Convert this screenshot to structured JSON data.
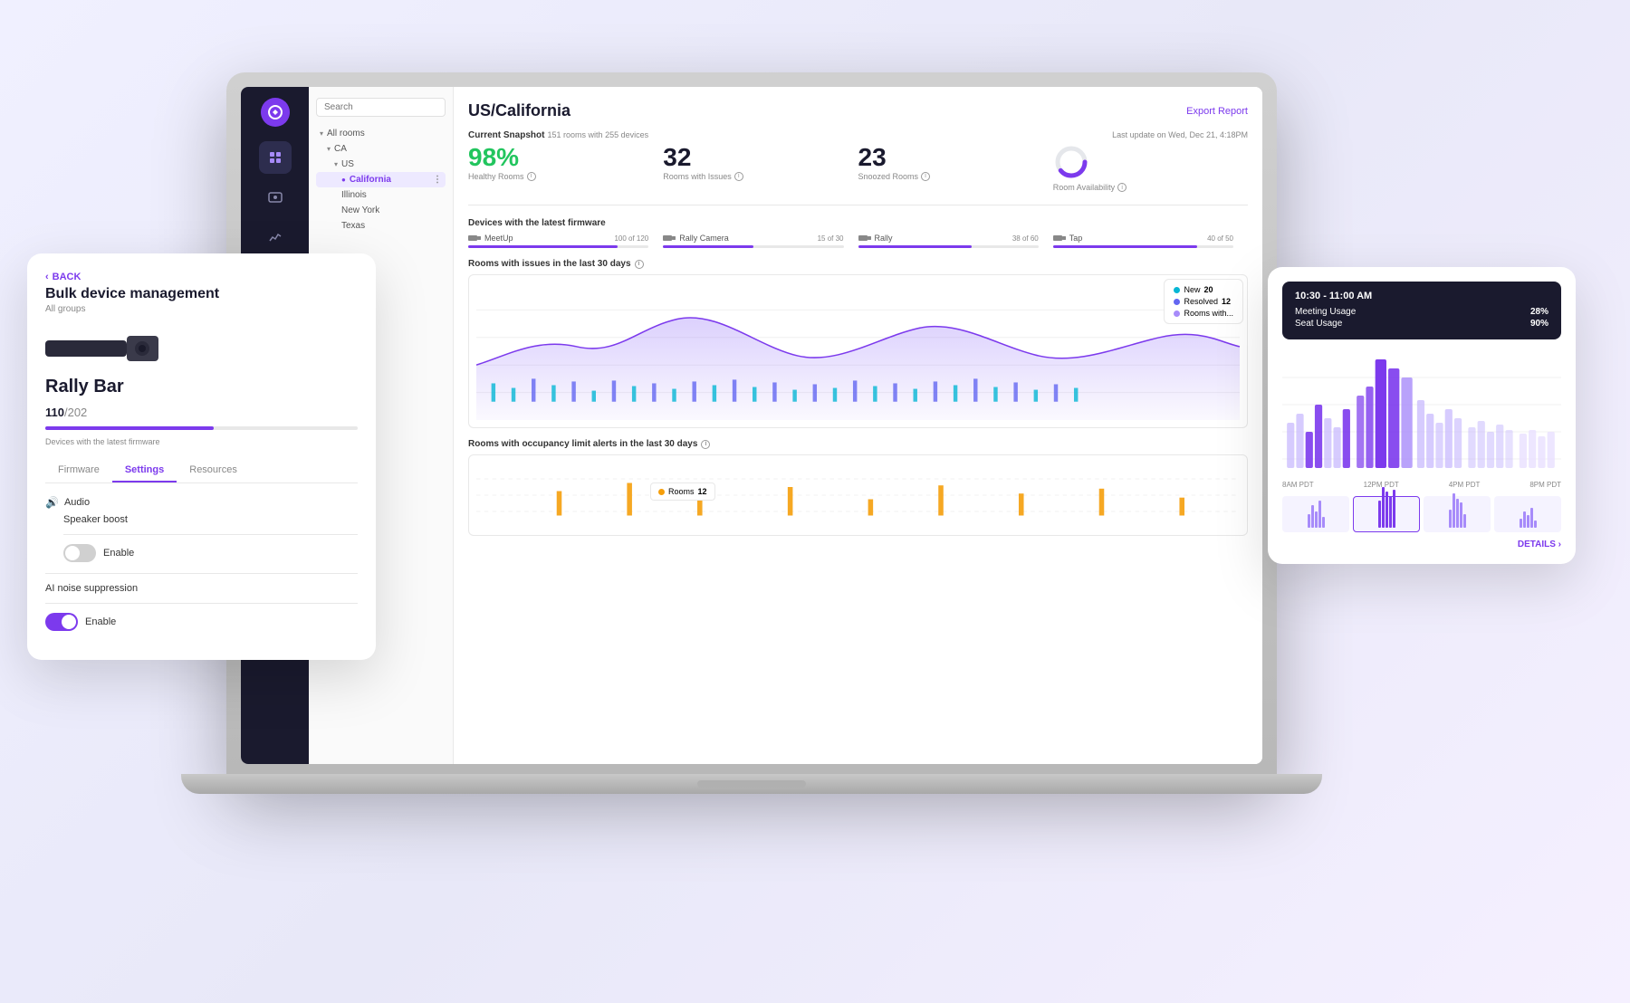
{
  "app": {
    "title": "US/California",
    "export_label": "Export Report"
  },
  "sidebar": {
    "logo": "L",
    "icons": [
      "🏠",
      "💻",
      "📊",
      "☁️",
      "💡",
      "⚙️"
    ]
  },
  "nav": {
    "search_placeholder": "Search",
    "items": [
      {
        "label": "All rooms",
        "level": 0,
        "expanded": true
      },
      {
        "label": "CA",
        "level": 1,
        "expanded": true
      },
      {
        "label": "US",
        "level": 2,
        "expanded": true
      },
      {
        "label": "California",
        "level": 3,
        "selected": true
      },
      {
        "label": "Illinois",
        "level": 3
      },
      {
        "label": "New York",
        "level": 3
      },
      {
        "label": "Texas",
        "level": 3
      }
    ]
  },
  "snapshot": {
    "label": "Current Snapshot",
    "rooms": "151 rooms",
    "devices": "255 devices",
    "update": "Last update on Wed, Dec 21, 4:18PM"
  },
  "metrics": [
    {
      "value": "98%",
      "label": "Healthy Rooms",
      "color": "#22c55e"
    },
    {
      "value": "32",
      "label": "Rooms with Issues"
    },
    {
      "value": "23",
      "label": "Snoozed Rooms"
    },
    {
      "value": "",
      "label": "Room Availability",
      "type": "donut"
    }
  ],
  "firmware": {
    "title": "Devices with the latest firmware",
    "items": [
      {
        "name": "MeetUp",
        "current": 100,
        "total": 120,
        "label": "100 of 120",
        "color": "#7c3aed",
        "pct": 83
      },
      {
        "name": "Rally Camera",
        "current": 15,
        "total": 30,
        "label": "15 of 30",
        "color": "#7c3aed",
        "pct": 50
      },
      {
        "name": "Rally",
        "current": 38,
        "total": 60,
        "label": "38 of 60",
        "color": "#7c3aed",
        "pct": 63
      },
      {
        "name": "Tap",
        "current": 40,
        "total": 50,
        "label": "40 of 50",
        "color": "#7c3aed",
        "pct": 80
      }
    ]
  },
  "rooms_chart": {
    "title": "Rooms with issues in the last 30 days",
    "legend": [
      {
        "label": "New",
        "value": "20",
        "color": "#06b6d4"
      },
      {
        "label": "Resolved",
        "value": "12",
        "color": "#6366f1"
      },
      {
        "label": "Rooms with...",
        "color": "#e5e7eb"
      }
    ]
  },
  "occupancy_chart": {
    "title": "Rooms with occupancy limit alerts in the last 30 days",
    "legend": [
      {
        "label": "Rooms",
        "value": "12",
        "color": "#f59e0b"
      }
    ]
  },
  "bulk_card": {
    "back_label": "BACK",
    "title": "Bulk device management",
    "subtitle": "All groups",
    "device_name": "Rally Bar",
    "device_count": "110",
    "device_total": "/202",
    "firmware_label": "Devices with the latest firmware",
    "tabs": [
      "Firmware",
      "Settings",
      "Resources"
    ],
    "active_tab": "Settings",
    "settings": [
      {
        "name": "Audio",
        "icon": "🔊",
        "subsettings": [
          {
            "name": "Speaker boost",
            "toggle": "off",
            "toggle_label": "Enable"
          }
        ]
      },
      {
        "name": "AI noise suppression",
        "toggle": "on",
        "toggle_label": "Enable"
      }
    ],
    "progress_pct": 54
  },
  "usage_card": {
    "tooltip": {
      "time": "10:30 - 11:00 AM",
      "rows": [
        {
          "label": "Meeting Usage",
          "value": "28%"
        },
        {
          "label": "Seat Usage",
          "value": "90%"
        }
      ]
    },
    "time_labels": [
      "8AM PDT",
      "12PM PDT",
      "4PM PDT",
      "8PM PDT"
    ],
    "details_label": "DETAILS ›",
    "mini_bars": [
      [
        15,
        25,
        18,
        30,
        12,
        20,
        28
      ],
      [
        30,
        45,
        40,
        55,
        35,
        50,
        42
      ],
      [
        20,
        38,
        32,
        28,
        15,
        22,
        30
      ],
      [
        10,
        18,
        14,
        22,
        8,
        16,
        12
      ]
    ]
  }
}
